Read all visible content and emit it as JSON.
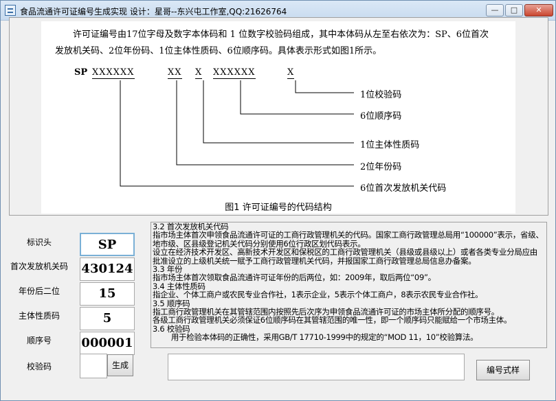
{
  "window": {
    "title": "食品流通许可证编号生成实现 设计：星哥--东兴屯工作室,QQ:21626764",
    "min_glyph": "—",
    "max_glyph": "□",
    "close_glyph": "✕"
  },
  "figure": {
    "intro": "许可证编号由17位字母及数字本体码和 1 位数字校验码组成，其中本体码从左至右依次为：SP、6位首次发放机关码、2位年份码、1位主体性质码、6位顺序码。具体表示形式如图1所示。",
    "code_segments": [
      "SP",
      "XXXXXX",
      "XX",
      "X",
      "XXXXXX",
      "X"
    ],
    "labels": [
      "1位校验码",
      "6位顺序码",
      "1位主体性质码",
      "2位年份码",
      "6位首次发放机关代码"
    ],
    "caption": "图1  许可证编号的代码结构"
  },
  "form": {
    "fields": [
      {
        "label": "标识头",
        "value": "SP"
      },
      {
        "label": "首次发放机关码",
        "value": "430124"
      },
      {
        "label": "年份后二位",
        "value": "15"
      },
      {
        "label": "主体性质码",
        "value": "5"
      },
      {
        "label": "顺序号",
        "value": "000001"
      },
      {
        "label": "校验码",
        "value": ""
      }
    ],
    "generate_label": "生成",
    "sample_label": "编号式样"
  },
  "explanation": [
    "3.2 首次发放机关代码",
    "指市场主体首次申领食品流通许可证的工商行政管理机关的代码。国家工商行政管理总局用“100000”表示，省级、地市级、区县级登记机关代码分别使用6位行政区划代码表示。",
    "设立在经济技术开发区、高新技术开发区和保税区的工商行政管理机关（县级或县级以上）或者各类专业分局应由批准设立的上级机关统一赋予工商行政管理机关代码，并报国家工商行政管理总局信息办备案。",
    "3.3 年份",
    "指市场主体首次领取食品流通许可证年份的后两位，如：2009年，取后两位“09”。",
    "3.4 主体性质码",
    "指企业、个体工商户或农民专业合作社，1表示企业，5表示个体工商户，8表示农民专业合作社。",
    "3.5 顺序码",
    "指工商行政管理机关在其管辖范围内按照先后次序为申领食品流通许可证的市场主体所分配的顺序号。",
    "各级工商行政管理机关必须保证6位顺序码在其管辖范围的唯一性，即一个顺序码只能赋给一个市场主体。",
    "3.6 校验码",
    "        用于检验本体码的正确性，采用GB/T 17710-1999中的规定的“MOD 11，10”校验算法。"
  ],
  "output": {
    "value": ""
  }
}
